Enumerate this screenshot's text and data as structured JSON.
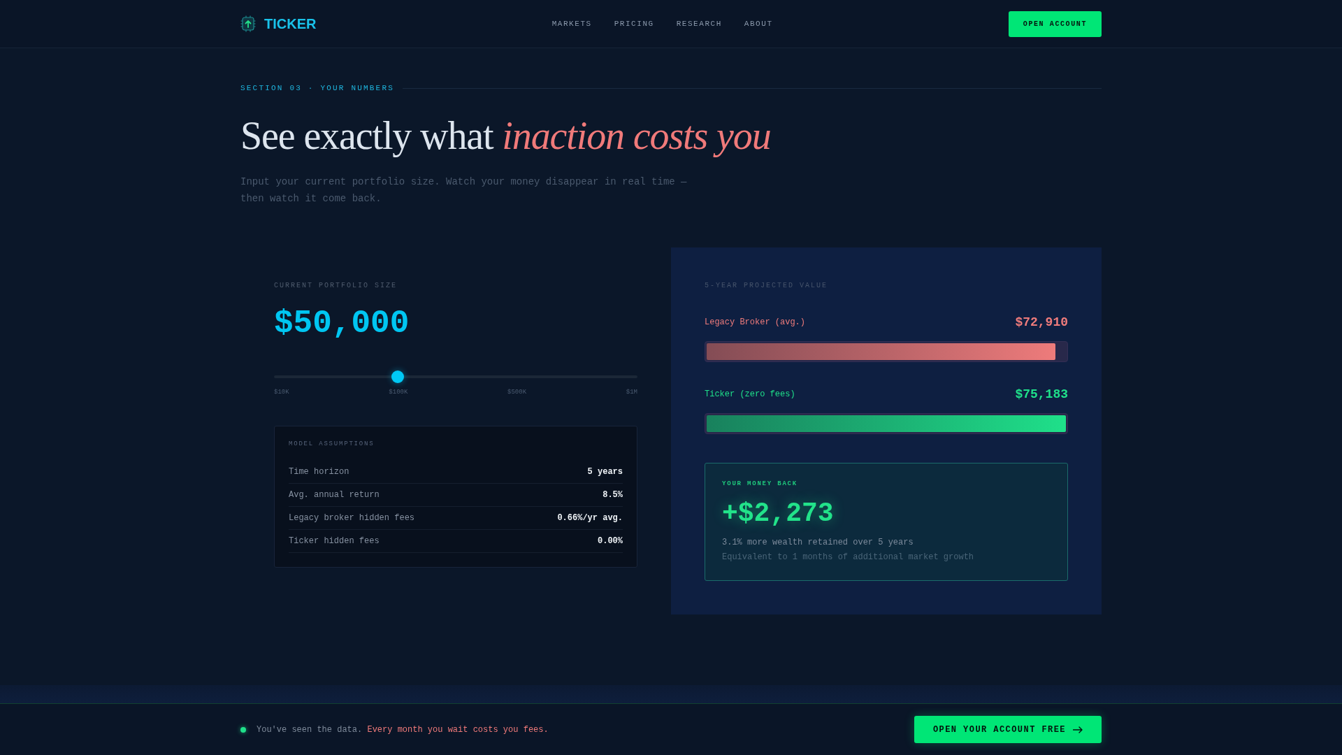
{
  "header": {
    "logo": "TICKER",
    "nav": [
      {
        "label": "MARKETS"
      },
      {
        "label": "PRICING"
      },
      {
        "label": "RESEARCH"
      },
      {
        "label": "ABOUT"
      }
    ],
    "cta": "OPEN ACCOUNT"
  },
  "intro": {
    "section_label": "SECTION 03 · YOUR NUMBERS",
    "heading": "See exactly what *inaction costs you*",
    "subtitle": "Input your current portfolio size. Watch your money disappear in real time — then watch it come back."
  },
  "portfolio": {
    "label": "CURRENT PORTFOLIO SIZE",
    "value": "$50,000",
    "slider": {
      "level": 0.34,
      "ticks": [
        "$10K",
        "$100K",
        "$500K",
        "$1M"
      ]
    },
    "assumptions": {
      "title": "MODEL ASSUMPTIONS",
      "rows": [
        {
          "label": "Time horizon",
          "value": "5 years"
        },
        {
          "label": "Avg. annual return",
          "value": "8.5%"
        },
        {
          "label": "Legacy broker hidden fees",
          "value": "0.66%/yr avg."
        },
        {
          "label": "Ticker hidden fees",
          "value": "0.00%"
        }
      ]
    }
  },
  "projection": {
    "label": "5-YEAR PROJECTED VALUE",
    "bars": [
      {
        "name": "Legacy Broker (avg.)",
        "value": "$72,910",
        "level": 0.97,
        "color": "#ee7b7b"
      },
      {
        "name": "Ticker (zero fees)",
        "value": "$75,183",
        "level": 1,
        "color": "#1fe08a"
      }
    ],
    "money_back": {
      "label": "YOUR MONEY BACK",
      "amount": "+$2,273",
      "note": "3.1% more wealth retained over 5 years",
      "detail": "Equivalent to 1 months of additional market growth"
    }
  },
  "cta_bar": {
    "message": "You've seen the data. **Every month you wait costs you fees.**",
    "button": "OPEN YOUR ACCOUNT FREE"
  }
}
